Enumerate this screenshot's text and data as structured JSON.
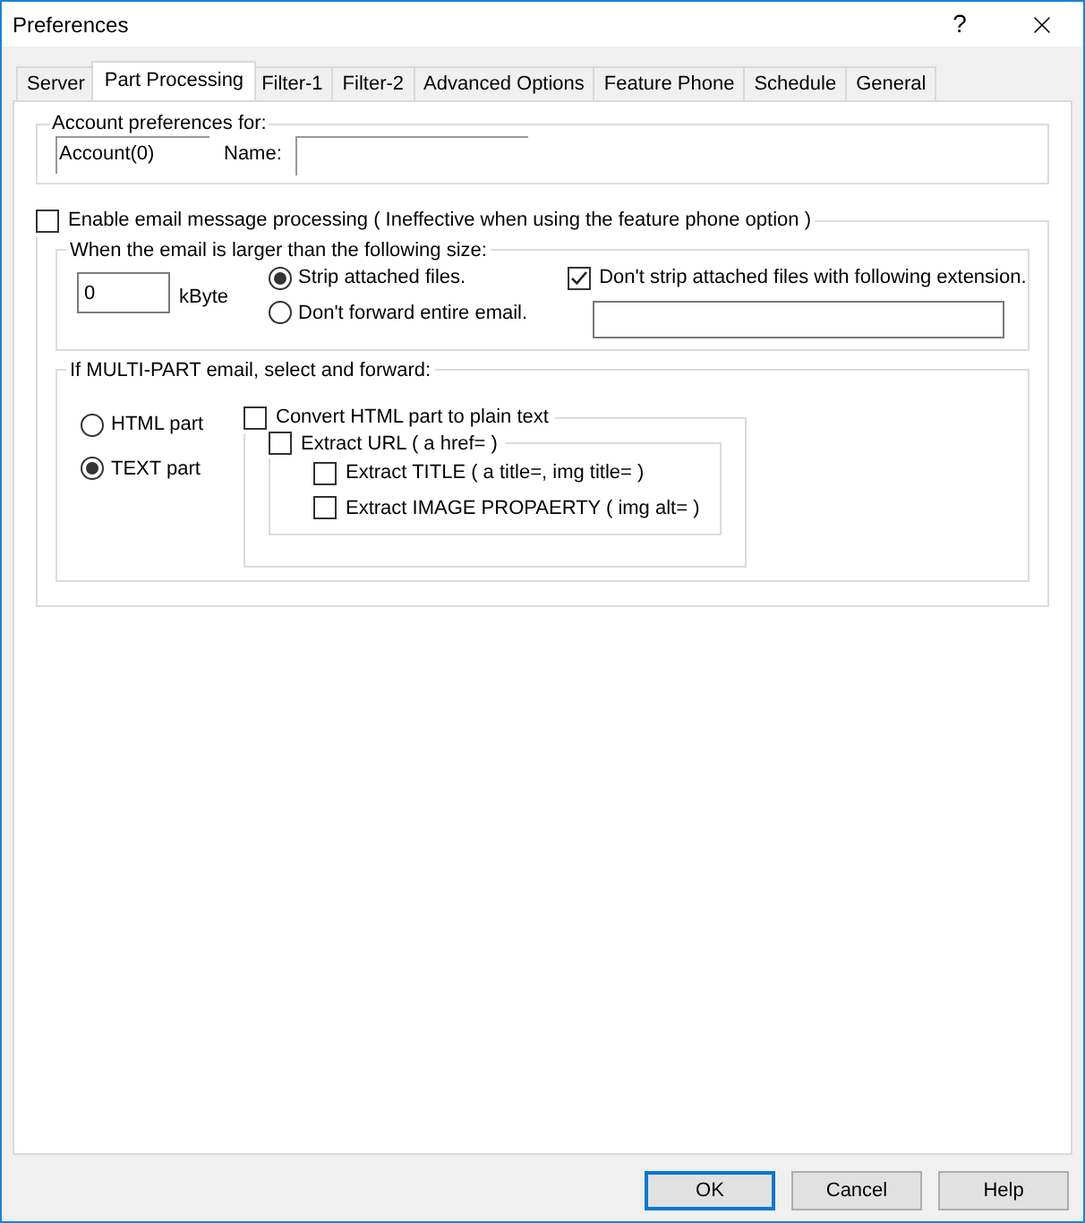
{
  "window": {
    "title": "Preferences",
    "help": "?"
  },
  "tabs": [
    {
      "label": "Server",
      "selected": false
    },
    {
      "label": "Part Processing",
      "selected": true
    },
    {
      "label": "Filter-1",
      "selected": false
    },
    {
      "label": "Filter-2",
      "selected": false
    },
    {
      "label": "Advanced Options",
      "selected": false
    },
    {
      "label": "Feature Phone",
      "selected": false
    },
    {
      "label": "Schedule",
      "selected": false
    },
    {
      "label": "General",
      "selected": false
    }
  ],
  "account": {
    "legend": "Account preferences for:",
    "account": "Account(0)",
    "name_label": "Name:"
  },
  "email_processing": {
    "label": "Enable email message processing ( Ineffective when using the feature phone option )",
    "checked": false,
    "size": {
      "legend": "When the email is larger than the following size:",
      "value": "0",
      "unit": "kByte",
      "options": [
        {
          "label": "Strip attached files.",
          "selected": true
        },
        {
          "label": "Don't forward entire email.",
          "selected": false
        }
      ],
      "keep_extension": {
        "label": "Don't strip attached files with following extension.",
        "checked": true
      }
    },
    "multipart": {
      "legend": "If MULTI-PART email, select and forward:",
      "parts": [
        {
          "label": "HTML part",
          "selected": false
        },
        {
          "label": "TEXT part",
          "selected": true
        }
      ],
      "convert": {
        "label": "Convert HTML part to plain text",
        "checked": false
      },
      "extract_url": {
        "label": "Extract URL ( a href= )",
        "checked": false
      },
      "extract_options": [
        {
          "label": "Extract TITLE ( a title=, img title= )",
          "checked": false
        },
        {
          "label": "Extract IMAGE PROPAERTY ( img alt= )",
          "checked": false
        }
      ]
    }
  },
  "buttons": [
    {
      "label": "OK",
      "default": true
    },
    {
      "label": "Cancel",
      "default": false
    },
    {
      "label": "Help",
      "default": false
    }
  ]
}
